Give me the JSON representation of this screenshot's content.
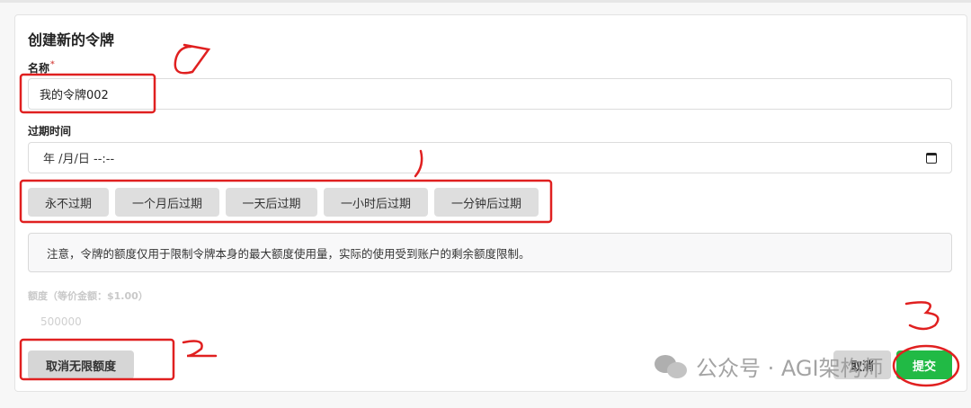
{
  "form": {
    "title": "创建新的令牌",
    "name_label": "名称",
    "required_mark": "*",
    "name_value": "我的令牌002",
    "expiry_label": "过期时间",
    "expiry_value": "年 /月/日 --:--",
    "expiry_buttons": [
      "永不过期",
      "一个月后过期",
      "一天后过期",
      "一小时后过期",
      "一分钟后过期"
    ],
    "notice": "注意，令牌的额度仅用于限制令牌本身的最大额度使用量，实际的使用受到账户的剩余额度限制。",
    "quota_label": "额度（等价金额：$1.00）",
    "quota_value": "500000",
    "unlimited_button": "取消无限额度",
    "cancel_button": "取消",
    "submit_button": "提交"
  },
  "watermark": {
    "text": "公众号 · AGI架构师"
  },
  "colors": {
    "submit": "#21ba45",
    "annotation": "#e02020"
  },
  "annotations": [
    "1",
    "2",
    "3"
  ]
}
